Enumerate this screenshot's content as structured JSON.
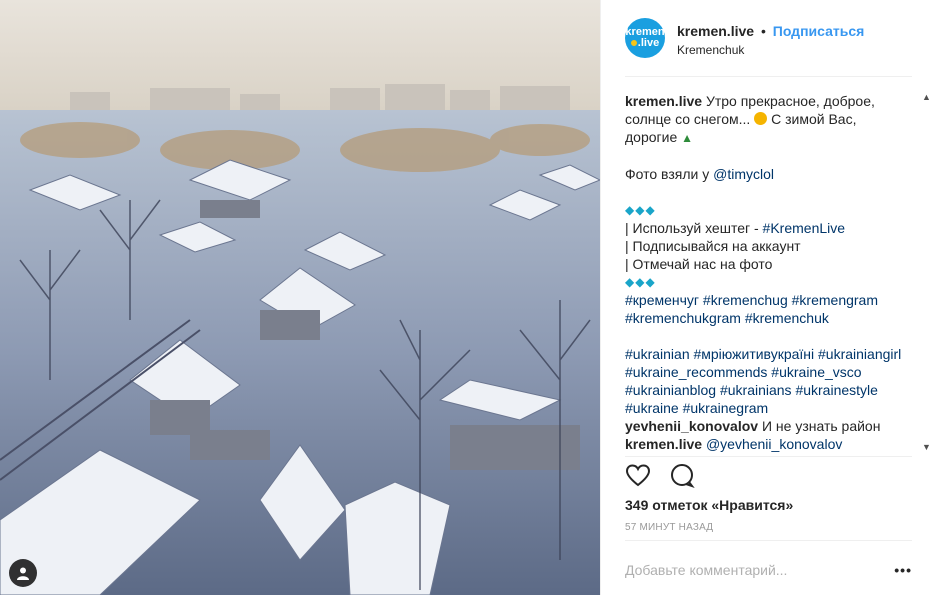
{
  "post": {
    "photo_alt": "photo-winter-town"
  },
  "header": {
    "avatar_line1": "kremen",
    "avatar_line2": ".live",
    "username": "kremen.live",
    "bullet": "•",
    "follow_label": "Подписаться",
    "location": "Kremenchuk"
  },
  "caption": {
    "username": "kremen.live",
    "line1": "Утро прекрасное, доброе, солнце со снегом... ",
    "line1b": " С зимой Вас, дорогие ",
    "photo_credit_text": "Фото взяли у ",
    "photo_credit_handle": "@timyclol",
    "diamonds": "◆◆◆",
    "hashtag_line_text": "| Используй хештег - ",
    "hashtag_line_tag": "#KremenLive",
    "subscribe_line": "| Подписывайся на аккаунт",
    "tag_line": "| Отмечай нас на фото",
    "tags1": "#кременчуг #kremenchug #kremengram #kremenchukgram #kremenchuk",
    "tags2": "#ukrainian #мріюжитивукраїні #ukrainiangirl #ukraine_recommends #ukraine_vsco #ukrainianblog #ukrainians #ukrainestyle #ukraine #ukrainegram"
  },
  "comments": [
    {
      "username": "yevhenii_konovalov",
      "text": "И не узнать район"
    },
    {
      "username": "kremen.live",
      "text": "@yevhenii_konovalov"
    }
  ],
  "actions": {
    "like_icon": "heart-icon",
    "comment_icon": "comment-icon"
  },
  "likes_text": "349 отметок «Нравится»",
  "time_ago": "57 МИНУТ НАЗАД",
  "add_comment_placeholder": "Добавьте комментарий...",
  "more_label": "•••",
  "colors": {
    "link_blue": "#3897f0",
    "hashtag_blue": "#003569",
    "avatar_blue": "#1a9fe0"
  }
}
